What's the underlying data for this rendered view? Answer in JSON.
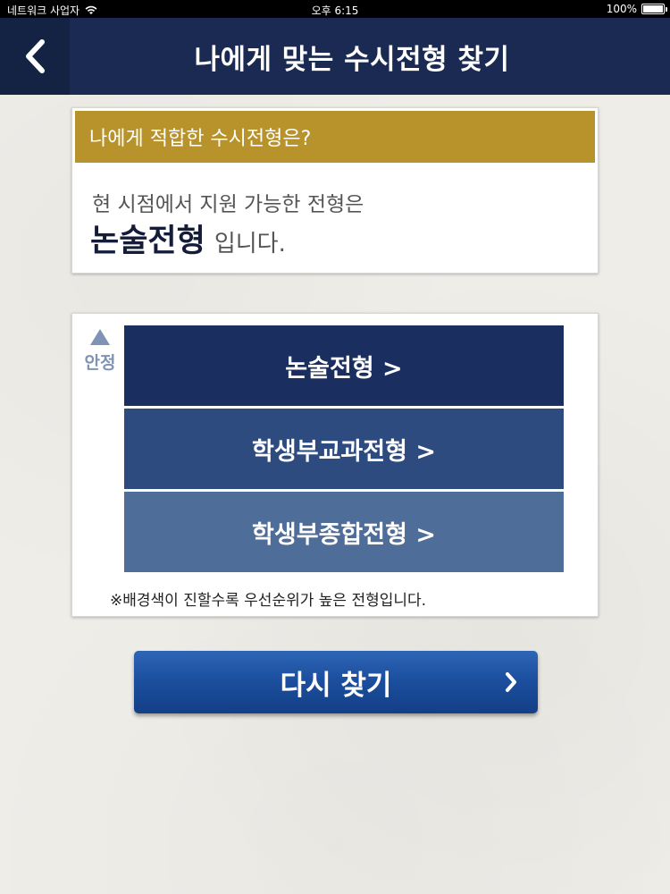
{
  "status_bar": {
    "carrier": "네트워크 사업자",
    "time": "오후 6:15",
    "battery": "100%",
    "battery_level": 1.0
  },
  "nav": {
    "title": "나에게 맞는 수시전형 찾기",
    "back_icon": "chevron-left-icon"
  },
  "result": {
    "header": "나에게 적합한 수시전형은?",
    "line1": "현 시점에서 지원 가능한 전형은",
    "type": "논술전형",
    "suffix": "입니다."
  },
  "ranking": {
    "stability_label": "안정",
    "options": [
      {
        "label": "논술전형 >",
        "color": "#1a2f60"
      },
      {
        "label": "학생부교과전형 >",
        "color": "#2d4b7e"
      },
      {
        "label": "학생부종합전형 >",
        "color": "#4e6d98"
      }
    ],
    "note": "※배경색이 진할수록 우선순위가 높은 전형입니다."
  },
  "retry": {
    "label": "다시 찾기",
    "icon": "chevron-right-icon"
  },
  "colors": {
    "nav_background": "#1a2a52",
    "header_gold": "#b8932c",
    "button_blue": "#1c4f9f"
  }
}
